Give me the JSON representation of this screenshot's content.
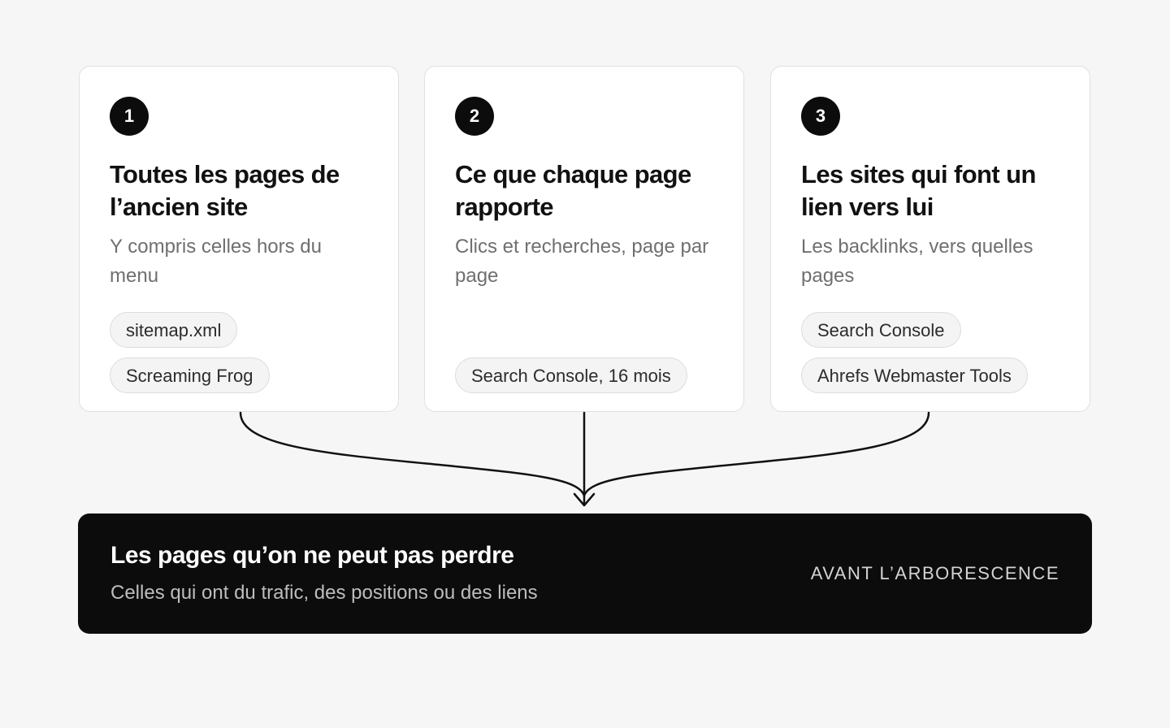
{
  "cards": [
    {
      "number": "1",
      "title": "Toutes les pages de l’ancien site",
      "subtitle": "Y compris celles hors du menu",
      "chips": [
        "sitemap.xml",
        "Screaming Frog"
      ]
    },
    {
      "number": "2",
      "title": "Ce que chaque page rapporte",
      "subtitle": "Clics et recherches, page par page",
      "chips": [
        "Search Console, 16 mois"
      ]
    },
    {
      "number": "3",
      "title": "Les sites qui font un lien vers lui",
      "subtitle": "Les backlinks, vers quelles pages",
      "chips": [
        "Search Console",
        "Ahrefs Webmaster Tools"
      ]
    }
  ],
  "result": {
    "title": "Les pages qu’on ne peut pas perdre",
    "subtitle": "Celles qui ont du trafic, des positions ou des liens",
    "tag": "AVANT L’ARBORESCENCE"
  },
  "colors": {
    "background": "#f6f6f6",
    "card": "#ffffff",
    "dark": "#0c0c0c",
    "muted_text": "#6f6f6f"
  }
}
